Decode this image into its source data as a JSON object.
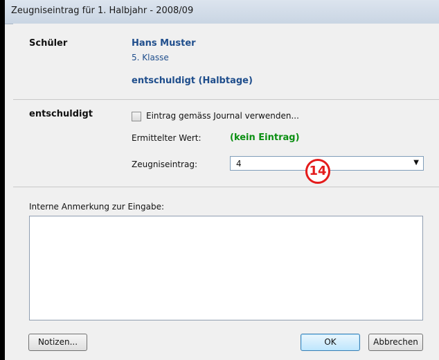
{
  "window": {
    "title": "Zeugniseintrag für 1. Halbjahr - 2008/09"
  },
  "student": {
    "section_label": "Schüler",
    "name": "Hans Muster",
    "class": "5. Klasse",
    "field_caption": "entschuldigt (Halbtage)"
  },
  "excused": {
    "section_label": "entschuldigt",
    "checkbox_label": "Eintrag gemäss Journal verwenden...",
    "checkbox_checked": false,
    "computed_label": "Ermittelter Wert:",
    "computed_value": "(kein Eintrag)",
    "entry_label": "Zeugniseintrag:",
    "entry_value": "4",
    "annotation_badge": "14"
  },
  "notes": {
    "label": "Interne Anmerkung zur Eingabe:",
    "value": ""
  },
  "buttons": {
    "notes": "Notizen...",
    "ok": "OK",
    "cancel": "Abbrechen"
  },
  "colors": {
    "accent": "#1f4e8c",
    "value_green": "#0b8f12",
    "badge_red": "#e41b1b"
  },
  "icons": {
    "dropdown": "chevron-down-icon"
  }
}
